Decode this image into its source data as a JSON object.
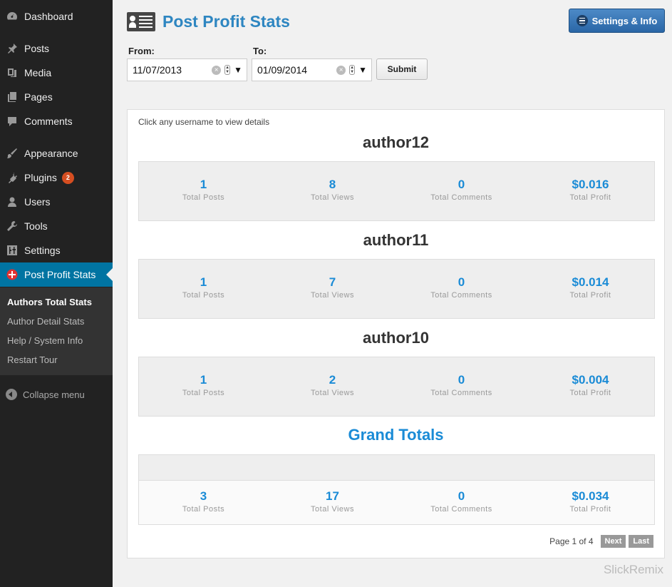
{
  "sidebar": {
    "items": [
      {
        "label": "Dashboard",
        "icon": "dashboard-icon"
      },
      {
        "label": "Posts",
        "icon": "pin-icon"
      },
      {
        "label": "Media",
        "icon": "media-icon"
      },
      {
        "label": "Pages",
        "icon": "pages-icon"
      },
      {
        "label": "Comments",
        "icon": "comment-icon"
      },
      {
        "label": "Appearance",
        "icon": "brush-icon"
      },
      {
        "label": "Plugins",
        "icon": "plug-icon",
        "badge": "2"
      },
      {
        "label": "Users",
        "icon": "user-icon"
      },
      {
        "label": "Tools",
        "icon": "wrench-icon"
      },
      {
        "label": "Settings",
        "icon": "sliders-icon"
      },
      {
        "label": "Post Profit Stats",
        "icon": "plugin-cross-icon",
        "active": true
      }
    ],
    "submenu": [
      "Authors Total Stats",
      "Author Detail Stats",
      "Help / System Info",
      "Restart Tour"
    ],
    "collapse_label": "Collapse menu"
  },
  "header": {
    "title": "Post Profit Stats",
    "settings_button": "Settings & Info"
  },
  "filters": {
    "from_label": "From:",
    "from_value": "11/07/2013",
    "to_label": "To:",
    "to_value": "01/09/2014",
    "submit_label": "Submit"
  },
  "stats": {
    "hint": "Click any username to view details",
    "captions": [
      "Total Posts",
      "Total Views",
      "Total Comments",
      "Total Profit"
    ],
    "authors": [
      {
        "name": "author12",
        "values": [
          "1",
          "8",
          "0",
          "$0.016"
        ]
      },
      {
        "name": "author11",
        "values": [
          "1",
          "7",
          "0",
          "$0.014"
        ]
      },
      {
        "name": "author10",
        "values": [
          "1",
          "2",
          "0",
          "$0.004"
        ]
      }
    ],
    "grand": {
      "title": "Grand Totals",
      "values": [
        "3",
        "17",
        "0",
        "$0.034"
      ]
    }
  },
  "pager": {
    "text": "Page 1 of 4",
    "next": "Next",
    "last": "Last"
  },
  "watermark": "SlickRemix",
  "colors": {
    "accent": "#1a8bd6",
    "sidebar": "#222222",
    "active": "#0074a2",
    "badge": "#d54e21"
  }
}
